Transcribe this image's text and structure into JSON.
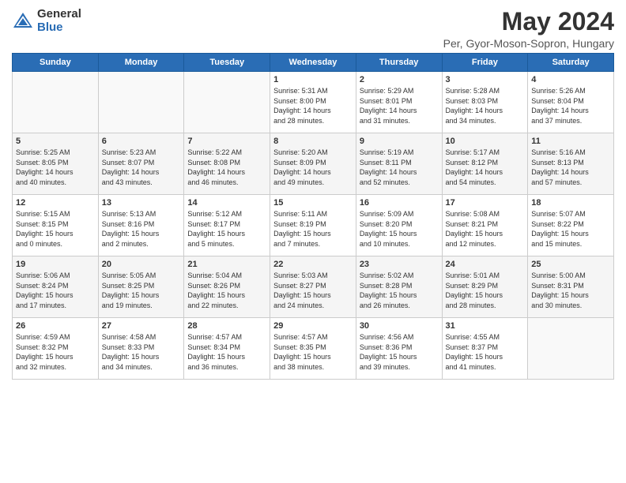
{
  "header": {
    "logo_general": "General",
    "logo_blue": "Blue",
    "month": "May 2024",
    "location": "Per, Gyor-Moson-Sopron, Hungary"
  },
  "days_of_week": [
    "Sunday",
    "Monday",
    "Tuesday",
    "Wednesday",
    "Thursday",
    "Friday",
    "Saturday"
  ],
  "weeks": [
    [
      {
        "day": "",
        "info": ""
      },
      {
        "day": "",
        "info": ""
      },
      {
        "day": "",
        "info": ""
      },
      {
        "day": "1",
        "info": "Sunrise: 5:31 AM\nSunset: 8:00 PM\nDaylight: 14 hours\nand 28 minutes."
      },
      {
        "day": "2",
        "info": "Sunrise: 5:29 AM\nSunset: 8:01 PM\nDaylight: 14 hours\nand 31 minutes."
      },
      {
        "day": "3",
        "info": "Sunrise: 5:28 AM\nSunset: 8:03 PM\nDaylight: 14 hours\nand 34 minutes."
      },
      {
        "day": "4",
        "info": "Sunrise: 5:26 AM\nSunset: 8:04 PM\nDaylight: 14 hours\nand 37 minutes."
      }
    ],
    [
      {
        "day": "5",
        "info": "Sunrise: 5:25 AM\nSunset: 8:05 PM\nDaylight: 14 hours\nand 40 minutes."
      },
      {
        "day": "6",
        "info": "Sunrise: 5:23 AM\nSunset: 8:07 PM\nDaylight: 14 hours\nand 43 minutes."
      },
      {
        "day": "7",
        "info": "Sunrise: 5:22 AM\nSunset: 8:08 PM\nDaylight: 14 hours\nand 46 minutes."
      },
      {
        "day": "8",
        "info": "Sunrise: 5:20 AM\nSunset: 8:09 PM\nDaylight: 14 hours\nand 49 minutes."
      },
      {
        "day": "9",
        "info": "Sunrise: 5:19 AM\nSunset: 8:11 PM\nDaylight: 14 hours\nand 52 minutes."
      },
      {
        "day": "10",
        "info": "Sunrise: 5:17 AM\nSunset: 8:12 PM\nDaylight: 14 hours\nand 54 minutes."
      },
      {
        "day": "11",
        "info": "Sunrise: 5:16 AM\nSunset: 8:13 PM\nDaylight: 14 hours\nand 57 minutes."
      }
    ],
    [
      {
        "day": "12",
        "info": "Sunrise: 5:15 AM\nSunset: 8:15 PM\nDaylight: 15 hours\nand 0 minutes."
      },
      {
        "day": "13",
        "info": "Sunrise: 5:13 AM\nSunset: 8:16 PM\nDaylight: 15 hours\nand 2 minutes."
      },
      {
        "day": "14",
        "info": "Sunrise: 5:12 AM\nSunset: 8:17 PM\nDaylight: 15 hours\nand 5 minutes."
      },
      {
        "day": "15",
        "info": "Sunrise: 5:11 AM\nSunset: 8:19 PM\nDaylight: 15 hours\nand 7 minutes."
      },
      {
        "day": "16",
        "info": "Sunrise: 5:09 AM\nSunset: 8:20 PM\nDaylight: 15 hours\nand 10 minutes."
      },
      {
        "day": "17",
        "info": "Sunrise: 5:08 AM\nSunset: 8:21 PM\nDaylight: 15 hours\nand 12 minutes."
      },
      {
        "day": "18",
        "info": "Sunrise: 5:07 AM\nSunset: 8:22 PM\nDaylight: 15 hours\nand 15 minutes."
      }
    ],
    [
      {
        "day": "19",
        "info": "Sunrise: 5:06 AM\nSunset: 8:24 PM\nDaylight: 15 hours\nand 17 minutes."
      },
      {
        "day": "20",
        "info": "Sunrise: 5:05 AM\nSunset: 8:25 PM\nDaylight: 15 hours\nand 19 minutes."
      },
      {
        "day": "21",
        "info": "Sunrise: 5:04 AM\nSunset: 8:26 PM\nDaylight: 15 hours\nand 22 minutes."
      },
      {
        "day": "22",
        "info": "Sunrise: 5:03 AM\nSunset: 8:27 PM\nDaylight: 15 hours\nand 24 minutes."
      },
      {
        "day": "23",
        "info": "Sunrise: 5:02 AM\nSunset: 8:28 PM\nDaylight: 15 hours\nand 26 minutes."
      },
      {
        "day": "24",
        "info": "Sunrise: 5:01 AM\nSunset: 8:29 PM\nDaylight: 15 hours\nand 28 minutes."
      },
      {
        "day": "25",
        "info": "Sunrise: 5:00 AM\nSunset: 8:31 PM\nDaylight: 15 hours\nand 30 minutes."
      }
    ],
    [
      {
        "day": "26",
        "info": "Sunrise: 4:59 AM\nSunset: 8:32 PM\nDaylight: 15 hours\nand 32 minutes."
      },
      {
        "day": "27",
        "info": "Sunrise: 4:58 AM\nSunset: 8:33 PM\nDaylight: 15 hours\nand 34 minutes."
      },
      {
        "day": "28",
        "info": "Sunrise: 4:57 AM\nSunset: 8:34 PM\nDaylight: 15 hours\nand 36 minutes."
      },
      {
        "day": "29",
        "info": "Sunrise: 4:57 AM\nSunset: 8:35 PM\nDaylight: 15 hours\nand 38 minutes."
      },
      {
        "day": "30",
        "info": "Sunrise: 4:56 AM\nSunset: 8:36 PM\nDaylight: 15 hours\nand 39 minutes."
      },
      {
        "day": "31",
        "info": "Sunrise: 4:55 AM\nSunset: 8:37 PM\nDaylight: 15 hours\nand 41 minutes."
      },
      {
        "day": "",
        "info": ""
      }
    ]
  ]
}
